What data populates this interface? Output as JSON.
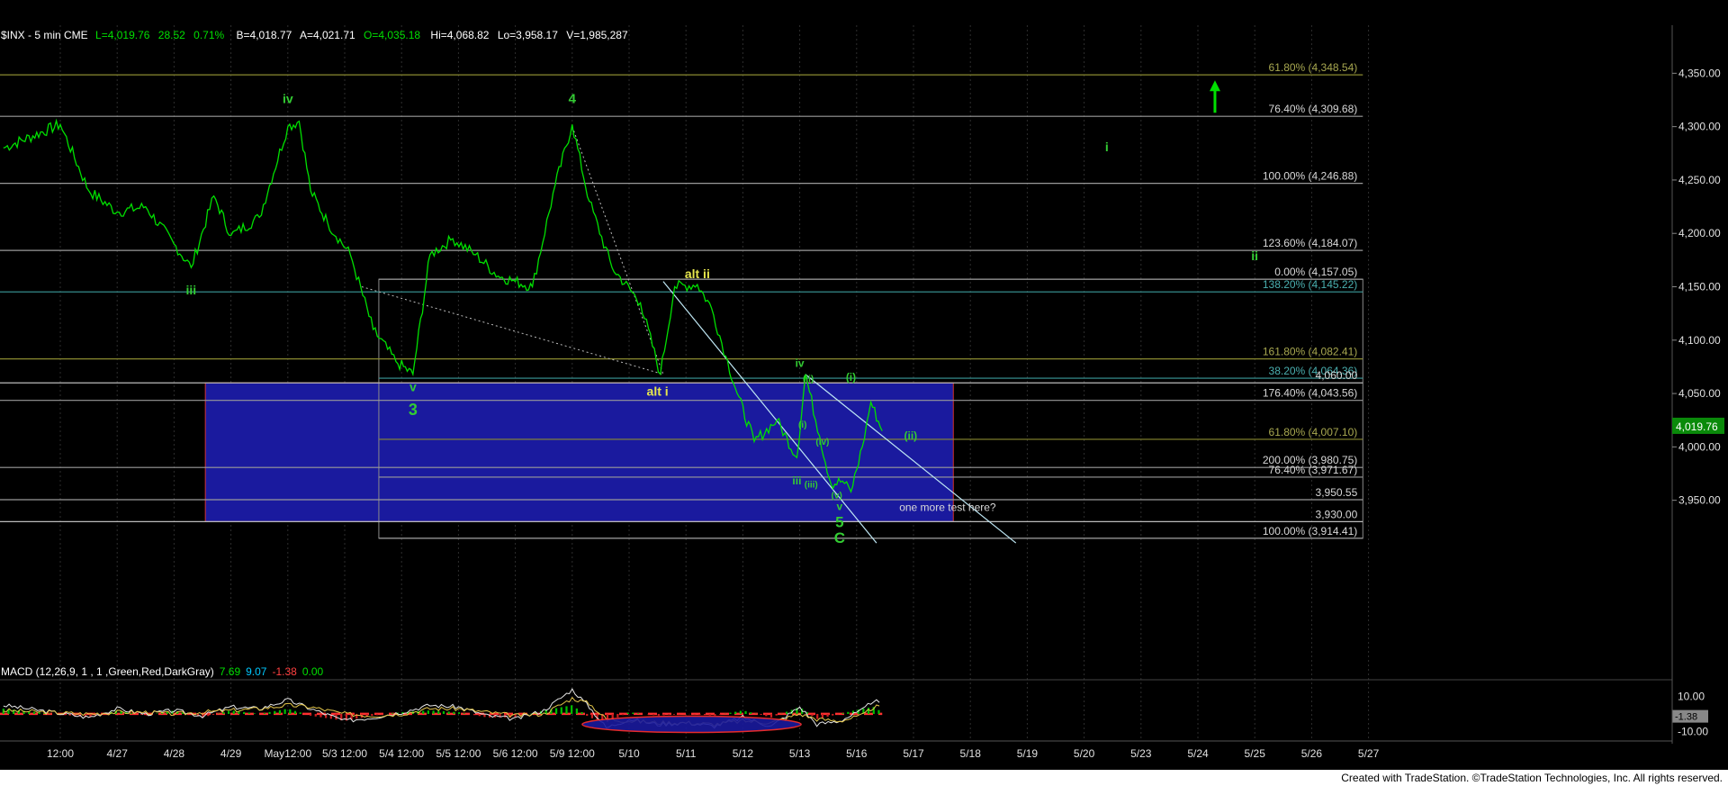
{
  "header": {
    "symbol": "$INX - 5 min  CME",
    "last": "L=4,019.76",
    "change": "28.52",
    "change_pct": "0.71%",
    "bid": "B=4,018.77",
    "ask": "A=4,021.71",
    "open": "O=4,035.18",
    "high": "Hi=4,068.82",
    "low": "Lo=3,958.17",
    "volume": "V=1,985,287"
  },
  "footer": {
    "credit": "Created with TradeStation. ©TradeStation Technologies, Inc. All rights reserved."
  },
  "colors": {
    "bg": "#000000",
    "price": "#00e000",
    "zone": "#1a1a9e",
    "grid": "#3a3a3a",
    "wave_green": "#33cc33",
    "wave_yellow": "#e6e64d"
  },
  "chart_data": {
    "type": "line",
    "title": "$INX - 5 min  CME",
    "ylim": [
      3905,
      4395
    ],
    "x_ticks": [
      "12:00",
      "4/27",
      "4/28",
      "4/29",
      "May12:00",
      "5/3 12:00",
      "5/4 12:00",
      "5/5 12:00",
      "5/6 12:00",
      "5/9 12:00",
      "5/10",
      "5/11",
      "5/12",
      "5/13",
      "5/16",
      "5/17",
      "5/18",
      "5/19",
      "5/20",
      "5/23",
      "5/24",
      "5/25",
      "5/26",
      "5/27"
    ],
    "y_ticks": [
      3950,
      4000,
      4050,
      4100,
      4150,
      4200,
      4250,
      4300,
      4350
    ],
    "y_tick_labels": [
      "3,950.00",
      "4,000.00",
      "4,050.00",
      "4,100.00",
      "4,150.00",
      "4,200.00",
      "4,250.00",
      "4,300.00",
      "4,350.00"
    ],
    "last_price": 4019.76,
    "last_price_label": "4,019.76",
    "price_path": [
      [
        -1,
        4280
      ],
      [
        0,
        4302
      ],
      [
        0.5,
        4240
      ],
      [
        1,
        4220
      ],
      [
        1.5,
        4225
      ],
      [
        2,
        4190
      ],
      [
        2.3,
        4168
      ],
      [
        2.7,
        4235
      ],
      [
        3,
        4198
      ],
      [
        3.5,
        4215
      ],
      [
        4,
        4300
      ],
      [
        4.2,
        4305
      ],
      [
        4.4,
        4240
      ],
      [
        4.7,
        4210
      ],
      [
        5.1,
        4180
      ],
      [
        5.5,
        4110
      ],
      [
        5.9,
        4080
      ],
      [
        6.2,
        4068
      ],
      [
        6.5,
        4180
      ],
      [
        6.9,
        4195
      ],
      [
        7.3,
        4180
      ],
      [
        7.7,
        4160
      ],
      [
        8,
        4155
      ],
      [
        8.3,
        4150
      ],
      [
        8.7,
        4245
      ],
      [
        9,
        4302
      ],
      [
        9.3,
        4230
      ],
      [
        9.7,
        4168
      ],
      [
        10.2,
        4135
      ],
      [
        10.55,
        4068
      ],
      [
        10.8,
        4150
      ],
      [
        11.2,
        4152
      ],
      [
        11.45,
        4130
      ],
      [
        11.7,
        4085
      ],
      [
        11.9,
        4050
      ],
      [
        12.2,
        4005
      ],
      [
        12.6,
        4025
      ],
      [
        12.95,
        3990
      ],
      [
        13.1,
        4068
      ],
      [
        13.35,
        4010
      ],
      [
        13.55,
        3965
      ],
      [
        13.75,
        3968
      ],
      [
        13.9,
        3958
      ],
      [
        14.1,
        4000
      ],
      [
        14.25,
        4042
      ],
      [
        14.45,
        4015
      ]
    ],
    "macd": {
      "label": "MACD (12,26,9, 1 , 1 ,Green,Red,DarkGray)",
      "values": [
        "7.69",
        "9.07",
        "-1.38",
        "0.00"
      ],
      "axis_labels": [
        "10.00",
        "-10.00"
      ],
      "current_label": "-1.38",
      "ylim": [
        -14,
        16
      ],
      "macd_line": [
        [
          -1,
          5
        ],
        [
          0.5,
          -2
        ],
        [
          1,
          3
        ],
        [
          1.5,
          0
        ],
        [
          2,
          2
        ],
        [
          2.5,
          -1
        ],
        [
          3,
          4
        ],
        [
          3.5,
          3
        ],
        [
          4,
          8
        ],
        [
          4.4,
          3
        ],
        [
          5,
          -4
        ],
        [
          5.5,
          -2
        ],
        [
          6,
          1
        ],
        [
          6.5,
          5
        ],
        [
          7,
          4
        ],
        [
          7.5,
          -1
        ],
        [
          8,
          -3
        ],
        [
          8.5,
          2
        ],
        [
          9,
          14
        ],
        [
          9.3,
          4
        ],
        [
          9.6,
          -8
        ],
        [
          10,
          -3
        ],
        [
          10.5,
          -6
        ],
        [
          11,
          -5
        ],
        [
          11.5,
          -7
        ],
        [
          12,
          -2
        ],
        [
          12.5,
          -7
        ],
        [
          13,
          4
        ],
        [
          13.3,
          -6
        ],
        [
          13.7,
          -4
        ],
        [
          14.1,
          2
        ],
        [
          14.3,
          8
        ],
        [
          14.45,
          5
        ]
      ],
      "signal_line": [
        [
          -1,
          2
        ],
        [
          0.5,
          0
        ],
        [
          1,
          1
        ],
        [
          1.5,
          1
        ],
        [
          2,
          0
        ],
        [
          2.5,
          1
        ],
        [
          3,
          2
        ],
        [
          3.5,
          3
        ],
        [
          4,
          5
        ],
        [
          4.4,
          4
        ],
        [
          5,
          0
        ],
        [
          5.5,
          -1
        ],
        [
          6,
          0
        ],
        [
          6.5,
          3
        ],
        [
          7,
          3
        ],
        [
          7.5,
          1
        ],
        [
          8,
          -1
        ],
        [
          8.5,
          0
        ],
        [
          9,
          9
        ],
        [
          9.3,
          6
        ],
        [
          9.6,
          -3
        ],
        [
          10,
          -4
        ],
        [
          10.5,
          -5
        ],
        [
          11,
          -5
        ],
        [
          11.5,
          -6
        ],
        [
          12,
          -4
        ],
        [
          12.5,
          -5
        ],
        [
          13,
          0
        ],
        [
          13.3,
          -3
        ],
        [
          13.7,
          -4
        ],
        [
          14.1,
          -1
        ],
        [
          14.3,
          4
        ],
        [
          14.45,
          4
        ]
      ]
    },
    "fib_levels": [
      {
        "label": "61.80% (4,348.54)",
        "value": 4348.54,
        "color": "#8a8a30",
        "x0": -1.2
      },
      {
        "label": "76.40% (4,309.68)",
        "value": 4309.68,
        "color": "#9a9a9a",
        "x0": -1.2
      },
      {
        "label": "100.00% (4,246.88)",
        "value": 4246.88,
        "color": "#9a9a9a",
        "x0": -1.2
      },
      {
        "label": "123.60% (4,184.07)",
        "value": 4184.07,
        "color": "#9a9a9a",
        "x0": -1.2
      },
      {
        "label": "0.00% (4,157.05)",
        "value": 4157.05,
        "color": "#9a9a9a",
        "x0": 5.6
      },
      {
        "label": "138.20% (4,145.22)",
        "value": 4145.22,
        "color": "#3a9a9a",
        "x0": -1.2
      },
      {
        "label": "161.80% (4,082.41)",
        "value": 4082.41,
        "color": "#8a8a30",
        "x0": -1.2
      },
      {
        "label": "38.20% (4,064.36)",
        "value": 4064.36,
        "color": "#3a9a9a",
        "x0": 5.6
      },
      {
        "label": "4,060.00",
        "value": 4060.0,
        "color": "#bbbbbb",
        "x0": -1.2
      },
      {
        "label": "176.40% (4,043.56)",
        "value": 4043.56,
        "color": "#9a9a9a",
        "x0": -1.2
      },
      {
        "label": "61.80% (4,007.10)",
        "value": 4007.1,
        "color": "#8a8a30",
        "x0": 5.6
      },
      {
        "label": "200.00% (3,980.75)",
        "value": 3980.75,
        "color": "#9a9a9a",
        "x0": -1.2
      },
      {
        "label": "76.40% (3,971.67)",
        "value": 3971.67,
        "color": "#9a9a9a",
        "x0": 5.6
      },
      {
        "label": "3,950.55",
        "value": 3950.55,
        "color": "#9a9a9a",
        "x0": -1.2
      },
      {
        "label": "3,930.00",
        "value": 3930.0,
        "color": "#bbbbbb",
        "x0": -1.2
      },
      {
        "label": "100.00% (3,914.41)",
        "value": 3914.41,
        "color": "#9a9a9a",
        "x0": 5.6
      }
    ],
    "target_zone": {
      "x_start": 2.55,
      "x_end": 15.7,
      "top": 4060.0,
      "bottom": 3930.0
    },
    "fib_box": {
      "x_start": 5.6,
      "x_end": 22.9,
      "top": 4157.05,
      "bottom": 3914.41
    },
    "channel_lines": [
      {
        "from": [
          10.6,
          4155
        ],
        "to": [
          14.35,
          3910
        ]
      },
      {
        "from": [
          13.1,
          4068
        ],
        "to": [
          16.8,
          3910
        ]
      }
    ],
    "dotted_lines": [
      {
        "from": [
          9.0,
          4300
        ],
        "to": [
          10.6,
          4068
        ]
      },
      {
        "from": [
          5.3,
          4150
        ],
        "to": [
          10.6,
          4068
        ]
      }
    ],
    "wave_labels": [
      {
        "text": "iv",
        "x": 4.0,
        "y": 4322,
        "color": "green",
        "size": 14
      },
      {
        "text": "4",
        "x": 9.0,
        "y": 4322,
        "color": "green",
        "size": 15
      },
      {
        "text": "iii",
        "x": 2.3,
        "y": 4143,
        "color": "green",
        "size": 14
      },
      {
        "text": "v",
        "x": 6.2,
        "y": 4052,
        "color": "green",
        "size": 14
      },
      {
        "text": "3",
        "x": 6.2,
        "y": 4030,
        "color": "green",
        "size": 18
      },
      {
        "text": "alt ii",
        "x": 11.2,
        "y": 4158,
        "color": "yellow",
        "size": 14
      },
      {
        "text": "alt i",
        "x": 10.5,
        "y": 4048,
        "color": "yellow",
        "size": 14
      },
      {
        "text": "iv",
        "x": 13.0,
        "y": 4075,
        "color": "green",
        "size": 12
      },
      {
        "text": "(ii)",
        "x": 13.15,
        "y": 4061,
        "color": "green",
        "size": 10
      },
      {
        "text": "(i)",
        "x": 13.9,
        "y": 4062,
        "color": "green",
        "size": 12
      },
      {
        "text": "(i)",
        "x": 13.05,
        "y": 4018,
        "color": "green",
        "size": 10
      },
      {
        "text": "(iv)",
        "x": 13.4,
        "y": 4002,
        "color": "green",
        "size": 10
      },
      {
        "text": "(ii)",
        "x": 14.95,
        "y": 4007,
        "color": "green",
        "size": 12
      },
      {
        "text": "iii",
        "x": 12.95,
        "y": 3965,
        "color": "green",
        "size": 12
      },
      {
        "text": "(iii)",
        "x": 13.2,
        "y": 3962,
        "color": "green",
        "size": 10
      },
      {
        "text": "(v)",
        "x": 13.65,
        "y": 3952,
        "color": "green",
        "size": 10
      },
      {
        "text": "v",
        "x": 13.7,
        "y": 3941,
        "color": "green",
        "size": 12
      },
      {
        "text": "5",
        "x": 13.7,
        "y": 3925,
        "color": "green",
        "size": 17
      },
      {
        "text": "C",
        "x": 13.7,
        "y": 3910,
        "color": "green",
        "size": 17
      },
      {
        "text": "i",
        "x": 18.4,
        "y": 4277,
        "color": "green",
        "size": 14
      },
      {
        "text": "ii",
        "x": 21.0,
        "y": 4175,
        "color": "green",
        "size": 14
      }
    ],
    "annotation": {
      "text": "one more test here?",
      "x": 15.6,
      "y": 3940
    },
    "arrow": {
      "x": 20.3,
      "y_from": 4313,
      "y_to": 4340
    }
  }
}
